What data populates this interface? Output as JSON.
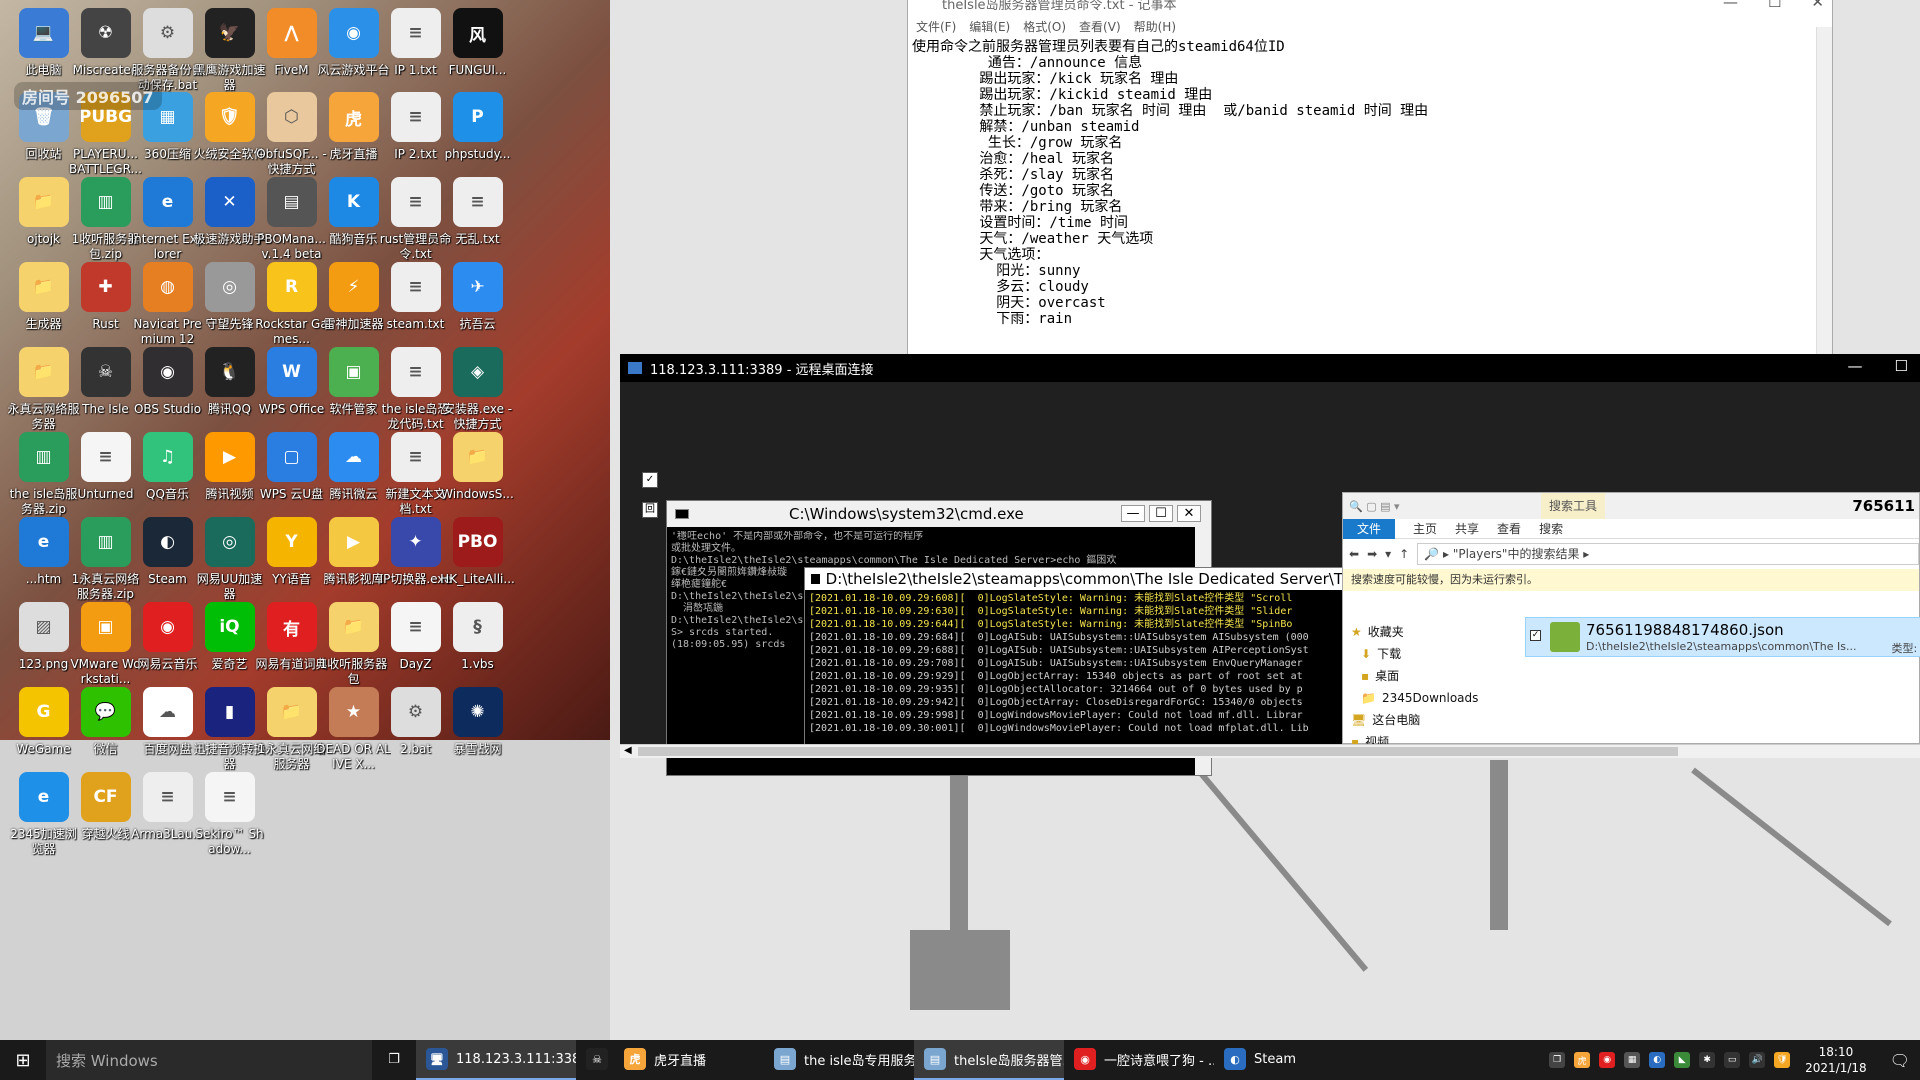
{
  "desktop": {
    "icons": [
      {
        "label": "此电脑",
        "glyph": "💻",
        "color": "#3a7bd5"
      },
      {
        "label": "Miscreated",
        "glyph": "☢",
        "color": "#444"
      },
      {
        "label": "服务器备份自动保存.bat",
        "glyph": "⚙",
        "color": "#ddd"
      },
      {
        "label": "黑鹰游戏加速器",
        "glyph": "🦅",
        "color": "#222"
      },
      {
        "label": "FiveM",
        "glyph": "⋀",
        "color": "#f28c28"
      },
      {
        "label": "风云游戏平台",
        "glyph": "◉",
        "color": "#2b90e8"
      },
      {
        "label": "IP 1.txt",
        "glyph": "≡",
        "color": "#eee"
      },
      {
        "label": "FUNGUI...",
        "glyph": "风",
        "color": "#111"
      },
      {
        "label": "回收站",
        "glyph": "🗑",
        "color": "#7aa6d0"
      },
      {
        "label": "PLAYERU... BATTLEGR...",
        "glyph": "PUBG",
        "color": "#e0a21c"
      },
      {
        "label": "360压缩",
        "glyph": "▦",
        "color": "#3aa0e0"
      },
      {
        "label": "火绒安全软件",
        "glyph": "🛡",
        "color": "#f5a623"
      },
      {
        "label": "ObfuSQF... - 快捷方式",
        "glyph": "⬡",
        "color": "#e8c89c"
      },
      {
        "label": "虎牙直播",
        "glyph": "虎",
        "color": "#f6a53a"
      },
      {
        "label": "IP 2.txt",
        "glyph": "≡",
        "color": "#eee"
      },
      {
        "label": "phpstudy...",
        "glyph": "P",
        "color": "#1e90e8"
      },
      {
        "label": "ojtojk",
        "glyph": "📁",
        "color": "#f5d26b"
      },
      {
        "label": "1收听服务器包.zip",
        "glyph": "▥",
        "color": "#2a9d5c"
      },
      {
        "label": "Internet Explorer",
        "glyph": "e",
        "color": "#1e7ad6"
      },
      {
        "label": "极速游戏助手",
        "glyph": "✕",
        "color": "#1b5fc9"
      },
      {
        "label": "PBOMana... v.1.4 beta",
        "glyph": "▤",
        "color": "#555"
      },
      {
        "label": "酷狗音乐",
        "glyph": "K",
        "color": "#1e88e5"
      },
      {
        "label": "rust管理员命令.txt",
        "glyph": "≡",
        "color": "#eee"
      },
      {
        "label": "无乱.txt",
        "glyph": "≡",
        "color": "#eee"
      },
      {
        "label": "生成器",
        "glyph": "📁",
        "color": "#f5d26b"
      },
      {
        "label": "Rust",
        "glyph": "✚",
        "color": "#c0392b"
      },
      {
        "label": "Navicat Premium 12",
        "glyph": "◍",
        "color": "#e67e22"
      },
      {
        "label": "守望先锋",
        "glyph": "◎",
        "color": "#999"
      },
      {
        "label": "Rockstar Games...",
        "glyph": "R",
        "color": "#f8c31a"
      },
      {
        "label": "雷神加速器",
        "glyph": "⚡",
        "color": "#f39c12"
      },
      {
        "label": "steam.txt",
        "glyph": "≡",
        "color": "#eee"
      },
      {
        "label": "抗吾云",
        "glyph": "✈",
        "color": "#2d8cf0"
      },
      {
        "label": "永真云网络服务器",
        "glyph": "📁",
        "color": "#f5d26b"
      },
      {
        "label": "The Isle",
        "glyph": "☠",
        "color": "#333"
      },
      {
        "label": "OBS Studio",
        "glyph": "◉",
        "color": "#302e31"
      },
      {
        "label": "腾讯QQ",
        "glyph": "🐧",
        "color": "#222"
      },
      {
        "label": "WPS Office",
        "glyph": "W",
        "color": "#2a7de1"
      },
      {
        "label": "软件管家",
        "glyph": "▣",
        "color": "#4caf50"
      },
      {
        "label": "the isle岛恐龙代码.txt",
        "glyph": "≡",
        "color": "#eee"
      },
      {
        "label": "安装器.exe - 快捷方式",
        "glyph": "◈",
        "color": "#1a6b5c"
      },
      {
        "label": "the isle岛服务器.zip",
        "glyph": "▥",
        "color": "#2a9d5c"
      },
      {
        "label": "Unturned",
        "glyph": "≡",
        "color": "#f5f5f5"
      },
      {
        "label": "QQ音乐",
        "glyph": "♫",
        "color": "#31c27c"
      },
      {
        "label": "腾讯视频",
        "glyph": "▶",
        "color": "#ff9900"
      },
      {
        "label": "WPS 云U盘",
        "glyph": "▢",
        "color": "#2a7de1"
      },
      {
        "label": "腾讯微云",
        "glyph": "☁",
        "color": "#2d8cf0"
      },
      {
        "label": "新建文本文档.txt",
        "glyph": "≡",
        "color": "#eee"
      },
      {
        "label": "WindowsS...",
        "glyph": "📁",
        "color": "#f5d26b"
      },
      {
        "label": "...htm",
        "glyph": "e",
        "color": "#1e7ad6"
      },
      {
        "label": "1永真云网络服务器.zip",
        "glyph": "▥",
        "color": "#2a9d5c"
      },
      {
        "label": "Steam",
        "glyph": "◐",
        "color": "#1b2838"
      },
      {
        "label": "网易UU加速器",
        "glyph": "◎",
        "color": "#1a6b5c"
      },
      {
        "label": "YY语音",
        "glyph": "Y",
        "color": "#f5b400"
      },
      {
        "label": "腾讯影视库",
        "glyph": "▶",
        "color": "#f5c842"
      },
      {
        "label": "IP切换器.exe",
        "glyph": "✦",
        "color": "#3949ab"
      },
      {
        "label": "HK_LiteAlli...",
        "glyph": "PBO",
        "color": "#9e1b1b"
      },
      {
        "label": "123.png",
        "glyph": "▨",
        "color": "#ddd"
      },
      {
        "label": "VMware Workstati...",
        "glyph": "▣",
        "color": "#f39c12"
      },
      {
        "label": "网易云音乐",
        "glyph": "◉",
        "color": "#e02020"
      },
      {
        "label": "爱奇艺",
        "glyph": "iQ",
        "color": "#00be06"
      },
      {
        "label": "网易有道词典",
        "glyph": "有",
        "color": "#e02020"
      },
      {
        "label": "1收听服务器包",
        "glyph": "📁",
        "color": "#f5d26b"
      },
      {
        "label": "DayZ",
        "glyph": "≡",
        "color": "#f5f5f5"
      },
      {
        "label": "1.vbs",
        "glyph": "§",
        "color": "#eee"
      },
      {
        "label": "WeGame",
        "glyph": "G",
        "color": "#f5c400"
      },
      {
        "label": "微信",
        "glyph": "💬",
        "color": "#2dc100"
      },
      {
        "label": "百度网盘",
        "glyph": "☁",
        "color": "#fff"
      },
      {
        "label": "迅捷音频转换器",
        "glyph": "▮",
        "color": "#1a237e"
      },
      {
        "label": "1永真云网络服务器",
        "glyph": "📁",
        "color": "#f5d26b"
      },
      {
        "label": "DEAD OR ALIVE X...",
        "glyph": "★",
        "color": "#c47c56"
      },
      {
        "label": "2.bat",
        "glyph": "⚙",
        "color": "#ddd"
      },
      {
        "label": "暴雪战网",
        "glyph": "✺",
        "color": "#0d2b5c"
      },
      {
        "label": "2345加速浏览器",
        "glyph": "e",
        "color": "#1e90e8"
      },
      {
        "label": "穿越火线",
        "glyph": "CF",
        "color": "#e0a21c"
      },
      {
        "label": "Arma3Lau...",
        "glyph": "≡",
        "color": "#eee"
      },
      {
        "label": "Sekiro™ Shadow...",
        "glyph": "≡",
        "color": "#f5f5f5"
      }
    ]
  },
  "stream_overlay": {
    "room": "房间号 2096507"
  },
  "notepad": {
    "title": "theIsle岛服务器管理员命令.txt - 记事本",
    "menu": [
      "文件(F)",
      "编辑(E)",
      "格式(O)",
      "查看(V)",
      "帮助(H)"
    ],
    "lines": [
      "使用命令之前服务器管理员列表要有自己的steamid64位ID",
      "         通告：/announce 信息",
      "        踢出玩家：/kick 玩家名 理由",
      "        踢出玩家：/kickid steamid 理由",
      "        禁止玩家：/ban 玩家名 时间 理由  或/banid steamid 时间 理由",
      "        解禁：/unban steamid",
      "         生长：/grow 玩家名",
      "        治愈：/heal 玩家名",
      "        杀死：/slay 玩家名",
      "        传送：/goto 玩家名",
      "        带来：/bring 玩家名",
      "        设置时间：/time 时间",
      "        天气：/weather 天气选项",
      "",
      "",
      "        天气选项：",
      "          阳光：sunny",
      "          多云：cloudy",
      "          阴天：overcast",
      "          下雨：rain"
    ]
  },
  "rdp": {
    "title": "118.123.3.111:3389 - 远程桌面连接",
    "cmd_title": "C:\\Windows\\system32\\cmd.exe",
    "cmd_lines": [
      "'穩㕵echo' 不是内部或外部命令，也不是可运行的程序",
      "或批处理文件。",
      "",
      "D:\\theIsle2\\theIsle2\\steamapps\\common\\The Isle Dedicated Server>echo 鏂囦欢",
      "鎵€鏈夊叧閿煎姩鑽烽敊璇",
      "缂栬瘧鐘舵€",
      "",
      "D:\\theIsle2\\theIsle2\\steamapps\\common\\The Isle Dedicated Server>",
      "  涓嶅瓨鍦",
      "",
      "D:\\theIsle2\\theIsle2\\steamapps\\common\\The Isle Dedicated Server>",
      "S> srcds started.",
      "(18:09:05.95) srcds"
    ],
    "log_title": "D:\\theIsle2\\theIsle2\\steamapps\\common\\The Isle Dedicated Server\\T",
    "log_lines": [
      {
        "t": "[2021.01.18-10.09.29:608][  0]LogSlateStyle: Warning: 未能找到Slate控件类型 \"Scroll",
        "c": "#f3e34d"
      },
      {
        "t": "[2021.01.18-10.09.29:630][  0]LogSlateStyle: Warning: 未能找到Slate控件类型 \"Slider",
        "c": "#f3e34d"
      },
      {
        "t": "[2021.01.18-10.09.29:644][  0]LogSlateStyle: Warning: 未能找到Slate控件类型 \"SpinBo",
        "c": "#f3e34d"
      },
      {
        "t": "[2021.01.18-10.09.29:684][  0]LogAISub: UAISubsystem::UAISubsystem AISubsystem (000",
        "c": "#cfcfcf"
      },
      {
        "t": "[2021.01.18-10.09.29:688][  0]LogAISub: UAISubsystem::UAISubsystem AIPerceptionSyst",
        "c": "#cfcfcf"
      },
      {
        "t": "[2021.01.18-10.09.29:708][  0]LogAISub: UAISubsystem::UAISubsystem EnvQueryManager",
        "c": "#cfcfcf"
      },
      {
        "t": "[2021.01.18-10.09.29:929][  0]LogObjectArray: 15340 objects as part of root set at",
        "c": "#cfcfcf"
      },
      {
        "t": "[2021.01.18-10.09.29:935][  0]LogObjectAllocator: 3214664 out of 0 bytes used by p",
        "c": "#cfcfcf"
      },
      {
        "t": "[2021.01.18-10.09.29:942][  0]LogObjectArray: CloseDisregardForGC: 15340/0 objects",
        "c": "#cfcfcf"
      },
      {
        "t": "[2021.01.18-10.09.29:998][  0]LogWindowsMoviePlayer: Could not load mf.dll. Librar",
        "c": "#cfcfcf"
      },
      {
        "t": "[2021.01.18-10.09.30:001][  0]LogWindowsMoviePlayer: Could not load mfplat.dll. Lib",
        "c": "#cfcfcf"
      }
    ],
    "remote_icon_label": "回",
    "explorer": {
      "search_tools": "搜索工具",
      "title_num": "765611",
      "tabs": [
        "文件",
        "主页",
        "共享",
        "查看",
        "搜索"
      ],
      "address": "\"Players\"中的搜索结果",
      "info": "搜索速度可能较慢，因为未运行索引。",
      "nav": [
        "收藏夹",
        "下载",
        "桌面",
        "2345Downloads",
        "",
        "这台电脑",
        "视频"
      ],
      "result_name": "76561198848174860.json",
      "result_path": "D:\\theIsle2\\theIsle2\\steamapps\\common\\The Is...",
      "result_type": "类型: J"
    }
  },
  "taskbar": {
    "search_placeholder": "搜索 Windows",
    "buttons": [
      {
        "label": "118.123.3.111:338...",
        "glyph": "🖥",
        "color": "#2b5797",
        "active": true
      },
      {
        "label": "",
        "glyph": "☠",
        "color": "#222",
        "active": false
      },
      {
        "label": "虎牙直播",
        "glyph": "虎",
        "color": "#f6a53a",
        "active": false
      },
      {
        "label": "the isle岛专用服务...",
        "glyph": "▤",
        "color": "#7aa6d0",
        "active": false
      },
      {
        "label": "theIsle岛服务器管...",
        "glyph": "▤",
        "color": "#7aa6d0",
        "active": true
      },
      {
        "label": "一腔诗意喂了狗 - ...",
        "glyph": "◉",
        "color": "#e02020",
        "active": false
      },
      {
        "label": "Steam",
        "glyph": "◐",
        "color": "#2a6dc0",
        "active": false
      }
    ],
    "time": "18:10",
    "date": "2021/1/18"
  }
}
